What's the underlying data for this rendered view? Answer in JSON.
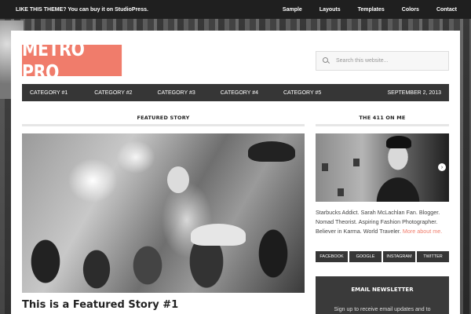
{
  "topbar": {
    "promo": "LIKE THIS THEME? You can buy it on StudioPress.",
    "nav": [
      "Sample",
      "Layouts",
      "Templates",
      "Colors",
      "Contact"
    ]
  },
  "header": {
    "logo": "METRO PRO",
    "search_placeholder": "Search this website..."
  },
  "menu": {
    "items": [
      "CATEGORY #1",
      "CATEGORY #2",
      "CATEGORY #3",
      "CATEGORY #4",
      "CATEGORY #5"
    ],
    "date": "SEPTEMBER 2, 2013"
  },
  "featured": {
    "section_title": "FEATURED STORY",
    "story_title": "This is a Featured Story #1"
  },
  "sidebar": {
    "section_title": "THE 411 ON ME",
    "bio": "Starbucks Addict. Sarah McLachlan Fan. Blogger. Nomad Theorist. Aspiring Fashion Photographer. Believer in Karma. World Traveler.",
    "bio_link": "More about me.",
    "social": [
      "FACEBOOK",
      "GOOGLE",
      "INSTAGRAM",
      "TWITTER"
    ],
    "newsletter_title": "EMAIL NEWSLETTER",
    "newsletter_text": "Sign up to receive email updates and to"
  },
  "colors": {
    "accent": "#f07c6b",
    "dark": "#363636"
  }
}
